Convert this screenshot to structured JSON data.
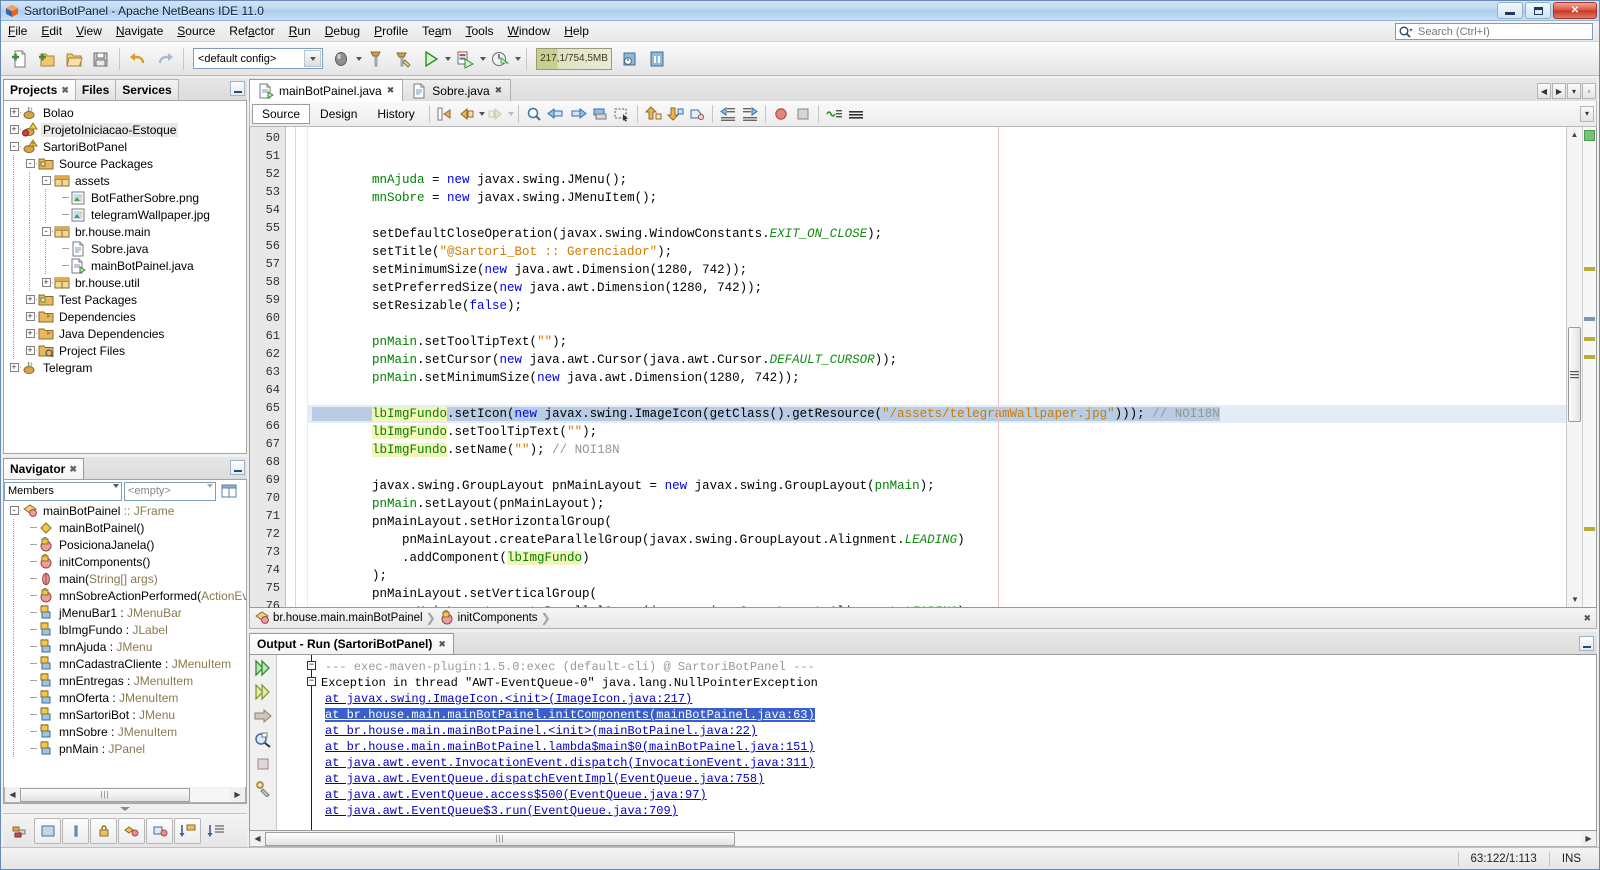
{
  "window": {
    "title": "SartoriBotPanel - Apache NetBeans IDE 11.0",
    "minimize_label": "Minimize",
    "maximize_label": "Restore",
    "close_label": "✕"
  },
  "menubar": {
    "items": [
      {
        "label": "File"
      },
      {
        "label": "Edit"
      },
      {
        "label": "View"
      },
      {
        "label": "Navigate"
      },
      {
        "label": "Source"
      },
      {
        "label": "Refactor"
      },
      {
        "label": "Run"
      },
      {
        "label": "Debug"
      },
      {
        "label": "Profile"
      },
      {
        "label": "Team"
      },
      {
        "label": "Tools"
      },
      {
        "label": "Window"
      },
      {
        "label": "Help"
      }
    ],
    "search_placeholder": "Search (Ctrl+I)"
  },
  "toolbar": {
    "config_value": "<default config>",
    "memory_gauge": "217,1/754,5MB",
    "buttons": [
      {
        "name": "new-file-button"
      },
      {
        "name": "new-project-button"
      },
      {
        "name": "open-project-button"
      },
      {
        "name": "save-all-button"
      },
      {
        "name": "undo-button"
      },
      {
        "name": "redo-button"
      },
      {
        "name": "set-main-project-button"
      },
      {
        "name": "build-project-button"
      },
      {
        "name": "clean-and-build-button"
      },
      {
        "name": "run-project-button"
      },
      {
        "name": "debug-project-button"
      },
      {
        "name": "profile-project-button"
      },
      {
        "name": "team-server-button"
      },
      {
        "name": "history-button"
      }
    ]
  },
  "left_panel": {
    "tabs": [
      {
        "label": "Projects",
        "active": true
      },
      {
        "label": "Files",
        "active": false
      },
      {
        "label": "Services",
        "active": false
      }
    ],
    "tree": [
      {
        "depth": 0,
        "toggle": "+",
        "icon": "java-project-icon",
        "label": "Bolao",
        "selected": false
      },
      {
        "depth": 0,
        "toggle": "+",
        "icon": "java-project-error-icon",
        "label": "ProjetoIniciacao-Estoque",
        "selected": true
      },
      {
        "depth": 0,
        "toggle": "-",
        "icon": "java-project-warning-icon",
        "label": "SartoriBotPanel",
        "selected": false
      },
      {
        "depth": 1,
        "toggle": "-",
        "icon": "source-packages-icon",
        "label": "Source Packages",
        "selected": false
      },
      {
        "depth": 2,
        "toggle": "-",
        "icon": "package-icon",
        "label": "assets",
        "selected": false
      },
      {
        "depth": 3,
        "toggle": "",
        "icon": "image-file-icon",
        "label": "BotFatherSobre.png",
        "selected": false
      },
      {
        "depth": 3,
        "toggle": "",
        "icon": "image-file-icon",
        "label": "telegramWallpaper.jpg",
        "selected": false
      },
      {
        "depth": 2,
        "toggle": "-",
        "icon": "package-icon",
        "label": "br.house.main",
        "selected": false
      },
      {
        "depth": 3,
        "toggle": "",
        "icon": "java-file-icon",
        "label": "Sobre.java",
        "selected": false
      },
      {
        "depth": 3,
        "toggle": "",
        "icon": "java-main-file-icon",
        "label": "mainBotPainel.java",
        "selected": false
      },
      {
        "depth": 2,
        "toggle": "+",
        "icon": "package-icon",
        "label": "br.house.util",
        "selected": false
      },
      {
        "depth": 1,
        "toggle": "+",
        "icon": "test-packages-icon",
        "label": "Test Packages",
        "selected": false
      },
      {
        "depth": 1,
        "toggle": "+",
        "icon": "dependencies-icon",
        "label": "Dependencies",
        "selected": false
      },
      {
        "depth": 1,
        "toggle": "+",
        "icon": "dependencies-icon",
        "label": "Java Dependencies",
        "selected": false
      },
      {
        "depth": 1,
        "toggle": "+",
        "icon": "project-files-icon",
        "label": "Project Files",
        "selected": false
      },
      {
        "depth": 0,
        "toggle": "+",
        "icon": "java-project-icon",
        "label": "Telegram",
        "selected": false
      }
    ]
  },
  "navigator": {
    "tab_label": "Navigator",
    "scope_value": "Members",
    "filter_value": "<empty>",
    "members": [
      {
        "depth": 0,
        "toggle": "-",
        "icon": "class-icon",
        "name": "mainBotPainel",
        "suffix": " :: JFrame",
        "suffix_dim": true
      },
      {
        "depth": 1,
        "toggle": "",
        "icon": "constructor-icon",
        "name": "mainBotPainel()",
        "suffix": "",
        "suffix_dim": false
      },
      {
        "depth": 1,
        "toggle": "",
        "icon": "method-private-icon",
        "name": "PosicionaJanela()",
        "suffix": "",
        "suffix_dim": false
      },
      {
        "depth": 1,
        "toggle": "",
        "icon": "method-private-icon",
        "name": "initComponents()",
        "suffix": "",
        "suffix_dim": false
      },
      {
        "depth": 1,
        "toggle": "",
        "icon": "method-static-icon",
        "name": "main(",
        "suffix": "String[] args)",
        "suffix_dim": true
      },
      {
        "depth": 1,
        "toggle": "",
        "icon": "method-private-icon",
        "name": "mnSobreActionPerformed(",
        "suffix": "ActionEvent",
        "suffix_dim": true
      },
      {
        "depth": 1,
        "toggle": "",
        "icon": "field-private-icon",
        "name": "jMenuBar1 : ",
        "suffix": "JMenuBar",
        "suffix_dim": true
      },
      {
        "depth": 1,
        "toggle": "",
        "icon": "field-private-icon",
        "name": "lbImgFundo : ",
        "suffix": "JLabel",
        "suffix_dim": true
      },
      {
        "depth": 1,
        "toggle": "",
        "icon": "field-private-icon",
        "name": "mnAjuda : ",
        "suffix": "JMenu",
        "suffix_dim": true
      },
      {
        "depth": 1,
        "toggle": "",
        "icon": "field-private-icon",
        "name": "mnCadastraCliente : ",
        "suffix": "JMenuItem",
        "suffix_dim": true
      },
      {
        "depth": 1,
        "toggle": "",
        "icon": "field-private-icon",
        "name": "mnEntregas : ",
        "suffix": "JMenuItem",
        "suffix_dim": true
      },
      {
        "depth": 1,
        "toggle": "",
        "icon": "field-private-icon",
        "name": "mnOferta : ",
        "suffix": "JMenuItem",
        "suffix_dim": true
      },
      {
        "depth": 1,
        "toggle": "",
        "icon": "field-private-icon",
        "name": "mnSartoriBot : ",
        "suffix": "JMenu",
        "suffix_dim": true
      },
      {
        "depth": 1,
        "toggle": "",
        "icon": "field-private-icon",
        "name": "mnSobre : ",
        "suffix": "JMenuItem",
        "suffix_dim": true
      },
      {
        "depth": 1,
        "toggle": "",
        "icon": "field-private-icon",
        "name": "pnMain : ",
        "suffix": "JPanel",
        "suffix_dim": true
      }
    ]
  },
  "editor": {
    "tabs": [
      {
        "label": "mainBotPainel.java",
        "icon": "java-main-file-icon",
        "active": true
      },
      {
        "label": "Sobre.java",
        "icon": "java-file-icon",
        "active": false
      }
    ],
    "view_tabs": [
      {
        "label": "Source",
        "active": true
      },
      {
        "label": "Design",
        "active": false
      },
      {
        "label": "History",
        "active": false
      }
    ],
    "first_line": 50,
    "highlight_line": 63,
    "lines": [
      {
        "n": 50,
        "segs": [
          {
            "t": "        ",
            "c": ""
          },
          {
            "t": "mnAjuda",
            "c": "f"
          },
          {
            "t": " = ",
            "c": ""
          },
          {
            "t": "new",
            "c": "k"
          },
          {
            "t": " javax.swing.JMenu();",
            "c": ""
          }
        ]
      },
      {
        "n": 51,
        "segs": [
          {
            "t": "        ",
            "c": ""
          },
          {
            "t": "mnSobre",
            "c": "f"
          },
          {
            "t": " = ",
            "c": ""
          },
          {
            "t": "new",
            "c": "k"
          },
          {
            "t": " javax.swing.JMenuItem();",
            "c": ""
          }
        ]
      },
      {
        "n": 52,
        "segs": [
          {
            "t": "",
            "c": ""
          }
        ]
      },
      {
        "n": 53,
        "segs": [
          {
            "t": "        setDefaultCloseOperation(javax.swing.WindowConstants.",
            "c": ""
          },
          {
            "t": "EXIT_ON_CLOSE",
            "c": "st"
          },
          {
            "t": ");",
            "c": ""
          }
        ]
      },
      {
        "n": 54,
        "segs": [
          {
            "t": "        setTitle(",
            "c": ""
          },
          {
            "t": "\"@Sartori_Bot :: Gerenciador\"",
            "c": "s"
          },
          {
            "t": ");",
            "c": ""
          }
        ]
      },
      {
        "n": 55,
        "segs": [
          {
            "t": "        setMinimumSize(",
            "c": ""
          },
          {
            "t": "new",
            "c": "k"
          },
          {
            "t": " java.awt.Dimension(1280, 742));",
            "c": ""
          }
        ]
      },
      {
        "n": 56,
        "segs": [
          {
            "t": "        setPreferredSize(",
            "c": ""
          },
          {
            "t": "new",
            "c": "k"
          },
          {
            "t": " java.awt.Dimension(1280, 742));",
            "c": ""
          }
        ]
      },
      {
        "n": 57,
        "segs": [
          {
            "t": "        setResizable(",
            "c": ""
          },
          {
            "t": "false",
            "c": "k"
          },
          {
            "t": ");",
            "c": ""
          }
        ]
      },
      {
        "n": 58,
        "segs": [
          {
            "t": "",
            "c": ""
          }
        ]
      },
      {
        "n": 59,
        "segs": [
          {
            "t": "        ",
            "c": ""
          },
          {
            "t": "pnMain",
            "c": "f"
          },
          {
            "t": ".setToolTipText(",
            "c": ""
          },
          {
            "t": "\"\"",
            "c": "s"
          },
          {
            "t": ");",
            "c": ""
          }
        ]
      },
      {
        "n": 60,
        "segs": [
          {
            "t": "        ",
            "c": ""
          },
          {
            "t": "pnMain",
            "c": "f"
          },
          {
            "t": ".setCursor(",
            "c": ""
          },
          {
            "t": "new",
            "c": "k"
          },
          {
            "t": " java.awt.Cursor(java.awt.Cursor.",
            "c": ""
          },
          {
            "t": "DEFAULT_CURSOR",
            "c": "st"
          },
          {
            "t": "));",
            "c": ""
          }
        ]
      },
      {
        "n": 61,
        "segs": [
          {
            "t": "        ",
            "c": ""
          },
          {
            "t": "pnMain",
            "c": "f"
          },
          {
            "t": ".setMinimumSize(",
            "c": ""
          },
          {
            "t": "new",
            "c": "k"
          },
          {
            "t": " java.awt.Dimension(1280, 742));",
            "c": ""
          }
        ]
      },
      {
        "n": 62,
        "segs": [
          {
            "t": "",
            "c": ""
          }
        ]
      },
      {
        "n": 63,
        "segs": [
          {
            "t": "        ",
            "c": ""
          },
          {
            "t": "lbImgFundo",
            "c": "f hlw"
          },
          {
            "t": ".setIcon(",
            "c": ""
          },
          {
            "t": "new",
            "c": "k"
          },
          {
            "t": " javax.swing.ImageIcon(getClass().getResource(",
            "c": ""
          },
          {
            "t": "\"/assets/telegramWallpaper.jpg\"",
            "c": "s"
          },
          {
            "t": ")));",
            "c": ""
          },
          {
            "t": " // NOI18N",
            "c": "c"
          }
        ]
      },
      {
        "n": 64,
        "segs": [
          {
            "t": "        ",
            "c": ""
          },
          {
            "t": "lbImgFundo",
            "c": "f hlw"
          },
          {
            "t": ".setToolTipText(",
            "c": ""
          },
          {
            "t": "\"\"",
            "c": "s"
          },
          {
            "t": ");",
            "c": ""
          }
        ]
      },
      {
        "n": 65,
        "segs": [
          {
            "t": "        ",
            "c": ""
          },
          {
            "t": "lbImgFundo",
            "c": "f hlw"
          },
          {
            "t": ".setName(",
            "c": ""
          },
          {
            "t": "\"\"",
            "c": "s"
          },
          {
            "t": "); ",
            "c": ""
          },
          {
            "t": "// NOI18N",
            "c": "c"
          }
        ]
      },
      {
        "n": 66,
        "segs": [
          {
            "t": "",
            "c": ""
          }
        ]
      },
      {
        "n": 67,
        "segs": [
          {
            "t": "        javax.swing.GroupLayout pnMainLayout = ",
            "c": ""
          },
          {
            "t": "new",
            "c": "k"
          },
          {
            "t": " javax.swing.GroupLayout(",
            "c": ""
          },
          {
            "t": "pnMain",
            "c": "f"
          },
          {
            "t": ");",
            "c": ""
          }
        ]
      },
      {
        "n": 68,
        "segs": [
          {
            "t": "        ",
            "c": ""
          },
          {
            "t": "pnMain",
            "c": "f"
          },
          {
            "t": ".setLayout(pnMainLayout);",
            "c": ""
          }
        ]
      },
      {
        "n": 69,
        "segs": [
          {
            "t": "        pnMainLayout.setHorizontalGroup(",
            "c": ""
          }
        ]
      },
      {
        "n": 70,
        "segs": [
          {
            "t": "            pnMainLayout.createParallelGroup(javax.swing.GroupLayout.Alignment.",
            "c": ""
          },
          {
            "t": "LEADING",
            "c": "st"
          },
          {
            "t": ")",
            "c": ""
          }
        ]
      },
      {
        "n": 71,
        "segs": [
          {
            "t": "            .addComponent(",
            "c": ""
          },
          {
            "t": "lbImgFundo",
            "c": "f hlw"
          },
          {
            "t": ")",
            "c": ""
          }
        ]
      },
      {
        "n": 72,
        "segs": [
          {
            "t": "        );",
            "c": ""
          }
        ]
      },
      {
        "n": 73,
        "segs": [
          {
            "t": "        pnMainLayout.setVerticalGroup(",
            "c": ""
          }
        ]
      },
      {
        "n": 74,
        "segs": [
          {
            "t": "            pnMainLayout.createParallelGroup(javax.swing.GroupLayout.Alignment.",
            "c": ""
          },
          {
            "t": "LEADING",
            "c": "st"
          },
          {
            "t": ")",
            "c": ""
          }
        ]
      },
      {
        "n": 75,
        "segs": [
          {
            "t": "            .addComponent(",
            "c": ""
          },
          {
            "t": "lbImgFundo",
            "c": "f hlw"
          },
          {
            "t": ")",
            "c": ""
          }
        ]
      },
      {
        "n": 76,
        "segs": [
          {
            "t": "        );",
            "c": ""
          }
        ]
      }
    ],
    "breadcrumb": [
      {
        "label": "br.house.main.mainBotPainel",
        "icon": "class-icon"
      },
      {
        "label": "initComponents",
        "icon": "method-private-icon"
      }
    ]
  },
  "output": {
    "tab_label": "Output - Run (SartoriBotPanel)",
    "lines": [
      {
        "text": "--- exec-maven-plugin:1.5.0:exec (default-cli) @ SartoriBotPanel ---",
        "style": "dim",
        "link": false,
        "selected": false
      },
      {
        "text": "Exception in thread \"AWT-EventQueue-0\" java.lang.NullPointerException",
        "style": "plain",
        "link": false,
        "selected": false
      },
      {
        "text": "\tat javax.swing.ImageIcon.<init>(ImageIcon.java:217)",
        "style": "link",
        "link": true,
        "selected": false
      },
      {
        "text": "\tat br.house.main.mainBotPainel.initComponents(mainBotPainel.java:63)",
        "style": "link",
        "link": true,
        "selected": true
      },
      {
        "text": "\tat br.house.main.mainBotPainel.<init>(mainBotPainel.java:22)",
        "style": "link",
        "link": true,
        "selected": false
      },
      {
        "text": "\tat br.house.main.mainBotPainel.lambda$main$0(mainBotPainel.java:151)",
        "style": "link",
        "link": true,
        "selected": false
      },
      {
        "text": "\tat java.awt.event.InvocationEvent.dispatch(InvocationEvent.java:311)",
        "style": "link",
        "link": true,
        "selected": false
      },
      {
        "text": "\tat java.awt.EventQueue.dispatchEventImpl(EventQueue.java:758)",
        "style": "link",
        "link": true,
        "selected": false
      },
      {
        "text": "\tat java.awt.EventQueue.access$500(EventQueue.java:97)",
        "style": "link",
        "link": true,
        "selected": false
      },
      {
        "text": "\tat java.awt.EventQueue$3.run(EventQueue.java:709)",
        "style": "link",
        "link": true,
        "selected": false
      }
    ],
    "side_buttons": [
      {
        "name": "rerun-button"
      },
      {
        "name": "rerun-with-different-params-button"
      },
      {
        "name": "goto-source-button"
      },
      {
        "name": "find-button"
      },
      {
        "name": "stop-button"
      },
      {
        "name": "settings-button"
      }
    ]
  },
  "statusbar": {
    "caret_position": "63:122/1:113",
    "insert_mode": "INS"
  },
  "colors": {
    "accent": "#3a5fcd",
    "keyword": "#0000e6",
    "string": "#ce7b00",
    "comment": "#969696",
    "field": "#008000",
    "static": "#128b12",
    "highlight_identifier": "#f5f5b9",
    "selected_line": "#e4ecf7",
    "titlebar": "#bcd7f0"
  }
}
